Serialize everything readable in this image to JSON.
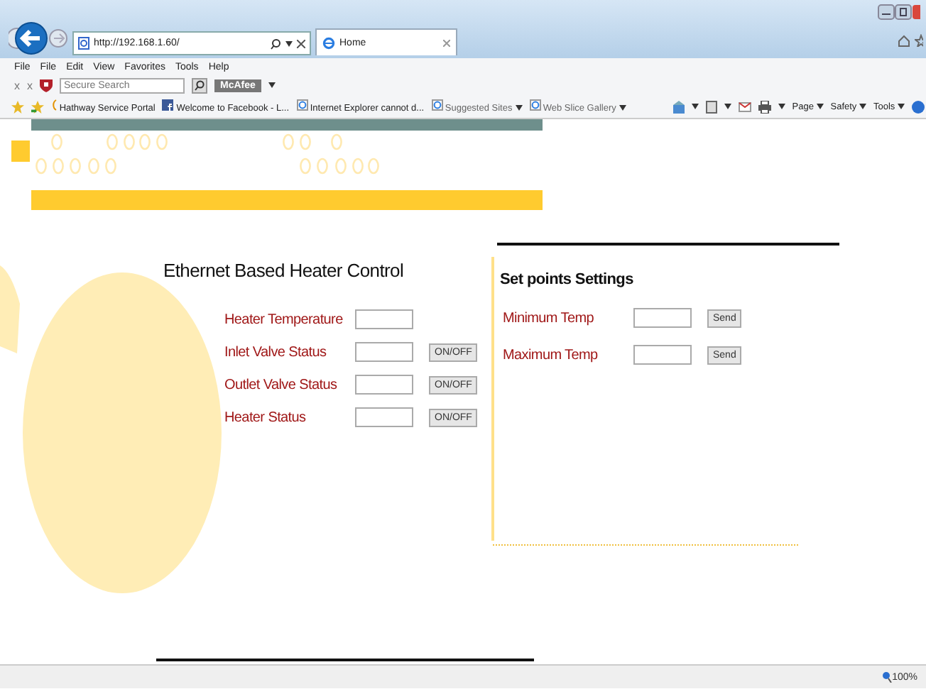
{
  "browser": {
    "address": "http://192.168.1.60/",
    "tabs": [
      {
        "label": "Home",
        "selected": true
      }
    ],
    "menu": [
      "File",
      "File",
      "Edit",
      "View",
      "Favorites",
      "Tools",
      "Help"
    ],
    "toolbar": {
      "close_marks": [
        "x",
        "x"
      ],
      "search_placeholder": "Secure Search",
      "mcafee": "McAfee"
    },
    "favorites": [
      {
        "label": "Hathway Service Portal",
        "dropdown": false
      },
      {
        "label": "Welcome to Facebook - L...",
        "dropdown": false
      },
      {
        "label": "Internet Explorer cannot d...",
        "dropdown": false
      },
      {
        "label": "Suggested Sites",
        "dropdown": true
      },
      {
        "label": "Web Slice Gallery",
        "dropdown": true
      }
    ],
    "commands": [
      "Page",
      "Safety",
      "Tools"
    ]
  },
  "page": {
    "title": "Ethernet Based Heater Control",
    "rows": [
      {
        "label": "Heater Temperature"
      },
      {
        "label": "Inlet Valve Status",
        "button": "ON/OFF"
      },
      {
        "label": "Outlet Valve Status",
        "button": "ON/OFF"
      },
      {
        "label": "Heater Status",
        "button": "ON/OFF"
      }
    ],
    "setpoints": {
      "title": "Set points Settings",
      "rows": [
        {
          "label": "Minimum Temp",
          "button": "Send"
        },
        {
          "label": "Maximum Temp",
          "button": "Send"
        }
      ]
    }
  },
  "status_bar": {
    "zoom": "100%"
  }
}
